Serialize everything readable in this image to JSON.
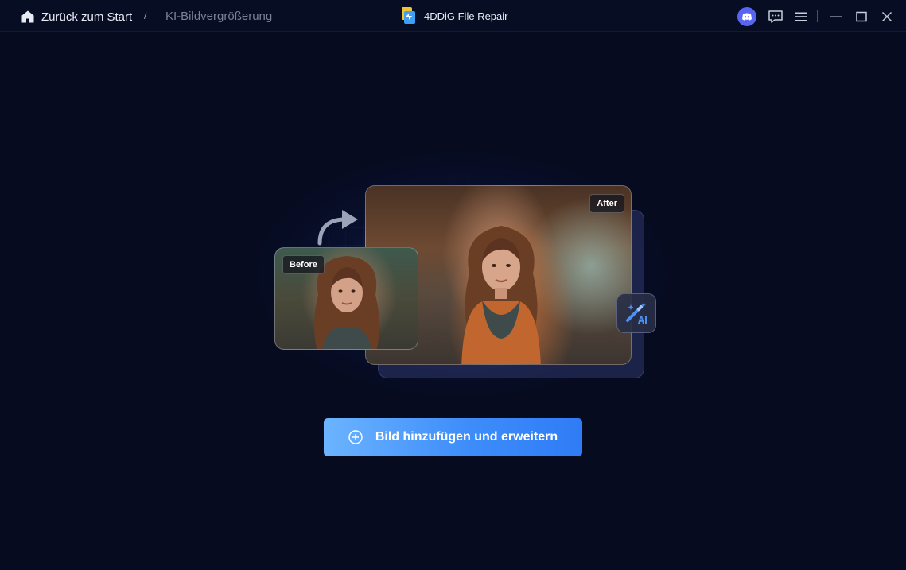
{
  "titlebar": {
    "home_label": "Zurück zum Start",
    "separator": "/",
    "current_page": "KI-Bildvergrößerung",
    "app_name": "4DDiG File Repair",
    "icons": {
      "home": "home-icon",
      "logo": "app-logo-icon",
      "discord": "discord-icon",
      "feedback": "chat-feedback-icon",
      "menu": "hamburger-menu-icon",
      "minimize": "minimize-icon",
      "maximize": "maximize-icon",
      "close": "close-icon"
    }
  },
  "hero": {
    "before_label": "Before",
    "after_label": "After",
    "ai_badge_icon": "magic-wand-ai-icon",
    "arrow_icon": "curved-arrow-icon"
  },
  "main": {
    "add_button_label": "Bild hinzufügen und erweitern",
    "add_button_icon": "plus-circle-icon"
  },
  "colors": {
    "background": "#060b20",
    "accent": "#3e8dfa",
    "discord": "#5865f2"
  }
}
